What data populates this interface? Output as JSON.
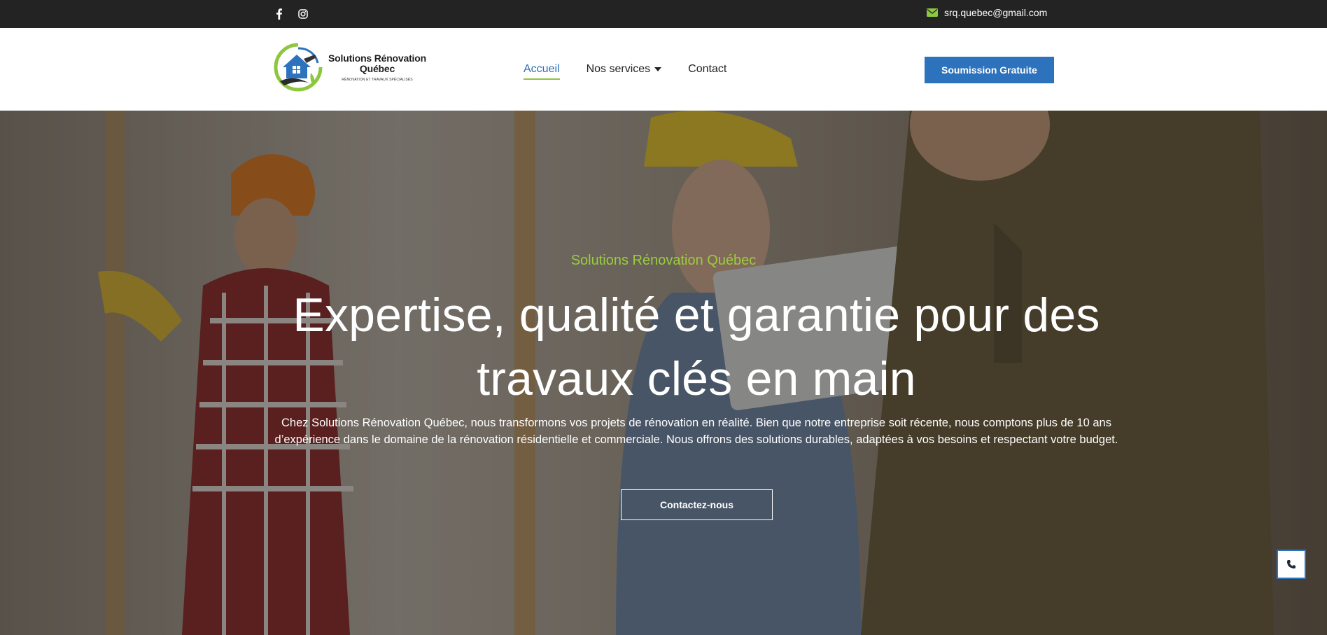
{
  "colors": {
    "topbar_bg": "#232323",
    "accent_blue": "#2d72bd",
    "accent_green": "#9acd3e",
    "text_dark": "#222222"
  },
  "topbar": {
    "social_icons": [
      "facebook-icon",
      "instagram-icon"
    ],
    "email_icon": "envelope-icon",
    "email": "srq.quebec@gmail.com"
  },
  "header": {
    "logo": {
      "title": "Solutions Rénovation Québec",
      "subtitle": "RÉNOVATION ET TRAVAUX SPÉCIALISÉS"
    },
    "nav": {
      "home": "Accueil",
      "services": "Nos services",
      "contact": "Contact"
    },
    "quote_button": "Soumission Gratuite"
  },
  "hero": {
    "kicker": "Solutions Rénovation Québec",
    "headline": "Expertise, qualité et garantie pour des travaux clés en main",
    "lead": "Chez Solutions Rénovation Québec, nous transformons vos projets de rénovation en réalité. Bien que notre entreprise soit récente, nous comptons plus de 10 ans d’expérience dans le domaine de la rénovation résidentielle et commerciale. Nous offrons des solutions durables, adaptées à vos besoins et respectant votre budget.",
    "cta": "Contactez-nous"
  },
  "floating": {
    "call_icon": "phone-icon"
  }
}
